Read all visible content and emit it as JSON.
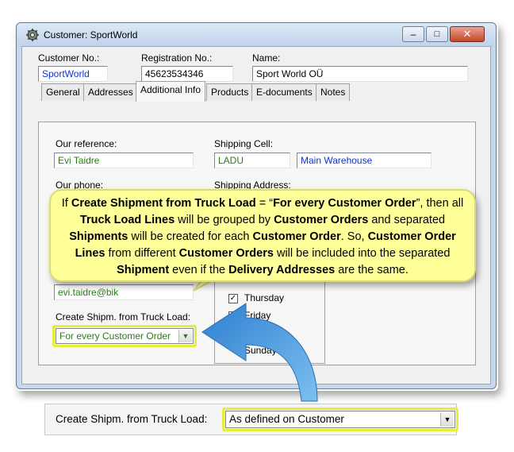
{
  "window": {
    "title": "Customer: SportWorld",
    "close_glyph": "✕",
    "min_glyph": "–",
    "max_glyph": "□"
  },
  "header": {
    "customer_no_label": "Customer No.:",
    "customer_no_value": "SportWorld",
    "registration_no_label": "Registration No.:",
    "registration_no_value": "45623534346",
    "name_label": "Name:",
    "name_value": "Sport World OÜ"
  },
  "tabs": [
    {
      "label": "General"
    },
    {
      "label": "Addresses"
    },
    {
      "label": "Additional Info"
    },
    {
      "label": "Products"
    },
    {
      "label": "E-documents"
    },
    {
      "label": "Notes"
    }
  ],
  "additional_info": {
    "our_reference_label": "Our reference:",
    "our_reference_value": "Evi Taidre",
    "shipping_cell_label": "Shipping Cell:",
    "shipping_cell_code": "LADU",
    "shipping_cell_name": "Main Warehouse",
    "our_phone_label": "Our phone:",
    "shipping_address_label": "Shipping Address:",
    "email_value": "evi.taidre@bik",
    "create_shipm_label": "Create Shipm. from Truck Load:",
    "create_shipm_value": "For every Customer Order",
    "days": [
      {
        "label": "Thursday",
        "checked": true
      },
      {
        "label": "Friday",
        "checked": false
      },
      {
        "label": "Sunday",
        "checked": false
      }
    ]
  },
  "callout": {
    "t1": "If ",
    "b1": "Create Shipment from Truck Load",
    "t2": " = “",
    "b2": "For every Customer Order",
    "t3": "”, then all ",
    "b3": "Truck Load Lines",
    "t4": " will be grouped by ",
    "b4": "Customer Orders",
    "t5": "  and separated ",
    "b5": "Shipments",
    "t6": " will be created for each ",
    "b6": "Customer Order",
    "t7": ".  So, ",
    "b7": "Customer Order Lines",
    "t8": " from different ",
    "b8": "Customer Orders",
    "t9": " will be included into the separated ",
    "b9": "Shipment",
    "t10": " even if the ",
    "b10": "Delivery Addresses",
    "t11": " are the same."
  },
  "bottom": {
    "label": "Create Shipm. from Truck Load:",
    "value": "As defined on Customer"
  },
  "colors": {
    "highlight": "#e6ee3c",
    "callout_bg": "#ffff99",
    "arrow": "#3f8fd6"
  }
}
